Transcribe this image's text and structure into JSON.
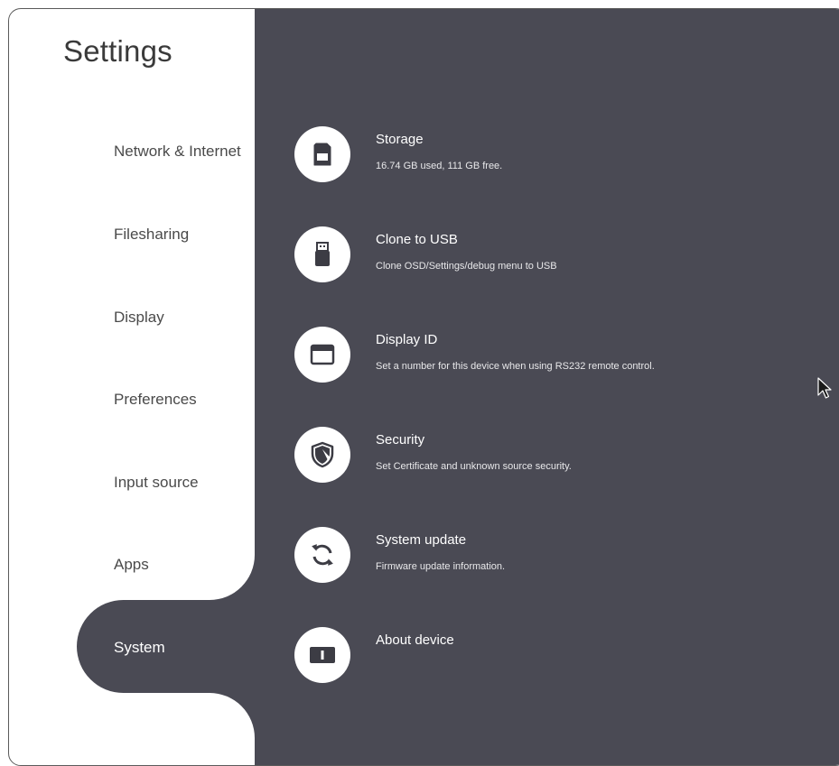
{
  "app": {
    "title": "Settings"
  },
  "sidebar": {
    "items": [
      {
        "label": "Network & Internet",
        "selected": false
      },
      {
        "label": "Filesharing",
        "selected": false
      },
      {
        "label": "Display",
        "selected": false
      },
      {
        "label": "Preferences",
        "selected": false
      },
      {
        "label": "Input source",
        "selected": false
      },
      {
        "label": "Apps",
        "selected": false
      },
      {
        "label": "System",
        "selected": true
      }
    ]
  },
  "main": {
    "rows": [
      {
        "title": "Storage",
        "subtitle": "16.74 GB used, 111 GB free.",
        "icon": "sd-card-icon"
      },
      {
        "title": "Clone to USB",
        "subtitle": "Clone OSD/Settings/debug menu to USB",
        "icon": "usb-drive-icon"
      },
      {
        "title": "Display ID",
        "subtitle": "Set a number for this device when using RS232 remote control.",
        "icon": "display-window-icon"
      },
      {
        "title": "Security",
        "subtitle": "Set Certificate and unknown source security.",
        "icon": "shield-icon"
      },
      {
        "title": "System update",
        "subtitle": "Firmware update information.",
        "icon": "sync-icon"
      },
      {
        "title": "About device",
        "subtitle": "",
        "icon": "device-info-icon"
      }
    ]
  },
  "colors": {
    "panel": "#4a4a54",
    "sidebar_bg": "#ffffff",
    "text_dark": "#4a4a4a",
    "text_light": "#ffffff"
  }
}
